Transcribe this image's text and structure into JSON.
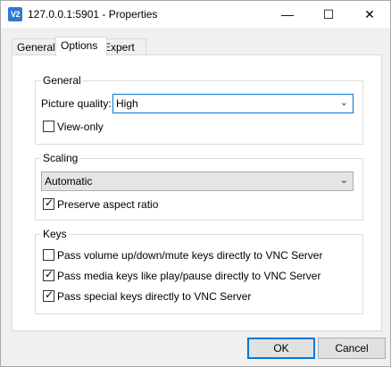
{
  "window": {
    "title": "127.0.0.1:5901 - Properties",
    "app_icon_text": "V2"
  },
  "titlebar": {
    "min": "—",
    "max": "☐",
    "close": "✕"
  },
  "tabs": [
    {
      "label": "General"
    },
    {
      "label": "Options",
      "active": true
    },
    {
      "label": "Expert"
    }
  ],
  "general": {
    "title": "General",
    "picture_quality_label": "Picture quality:",
    "picture_quality_value": "High",
    "view_only_label": "View-only",
    "view_only_checked": false
  },
  "scaling": {
    "title": "Scaling",
    "mode_value": "Automatic",
    "preserve_label": "Preserve aspect ratio",
    "preserve_checked": true
  },
  "keys": {
    "title": "Keys",
    "items": [
      {
        "label": "Pass volume up/down/mute keys directly to VNC Server",
        "checked": false
      },
      {
        "label": "Pass media keys like play/pause directly to VNC Server",
        "checked": true
      },
      {
        "label": "Pass special keys directly to VNC Server",
        "checked": true
      }
    ]
  },
  "buttons": {
    "ok": "OK",
    "cancel": "Cancel"
  },
  "glyphs": {
    "check": "✓",
    "chevron": "⌄"
  },
  "colors": {
    "accent": "#0078d7",
    "app_icon": "#2a7bd1"
  }
}
